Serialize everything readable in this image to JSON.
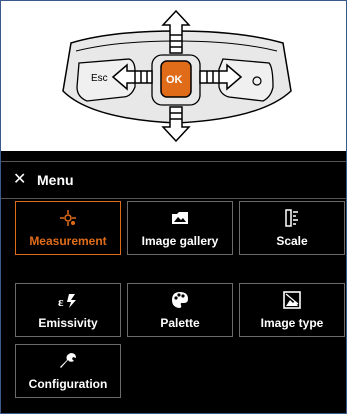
{
  "illustration": {
    "buttons": {
      "esc": "Esc",
      "ok": "OK"
    }
  },
  "menu": {
    "title": "Menu",
    "close_icon": "close-icon",
    "items": [
      {
        "label": "Measurement",
        "icon": "measurement-icon",
        "active": true
      },
      {
        "label": "Image gallery",
        "icon": "image-gallery-icon",
        "active": false
      },
      {
        "label": "Scale",
        "icon": "scale-icon",
        "active": false
      },
      {
        "label": "Emissivity",
        "icon": "emissivity-icon",
        "active": false
      },
      {
        "label": "Palette",
        "icon": "palette-icon",
        "active": false
      },
      {
        "label": "Image type",
        "icon": "image-type-icon",
        "active": false
      },
      {
        "label": "Configuration",
        "icon": "wrench-icon",
        "active": false
      }
    ]
  },
  "colors": {
    "accent": "#e06c1a",
    "panel": "#000000",
    "tile_border": "#6a6a6a"
  }
}
